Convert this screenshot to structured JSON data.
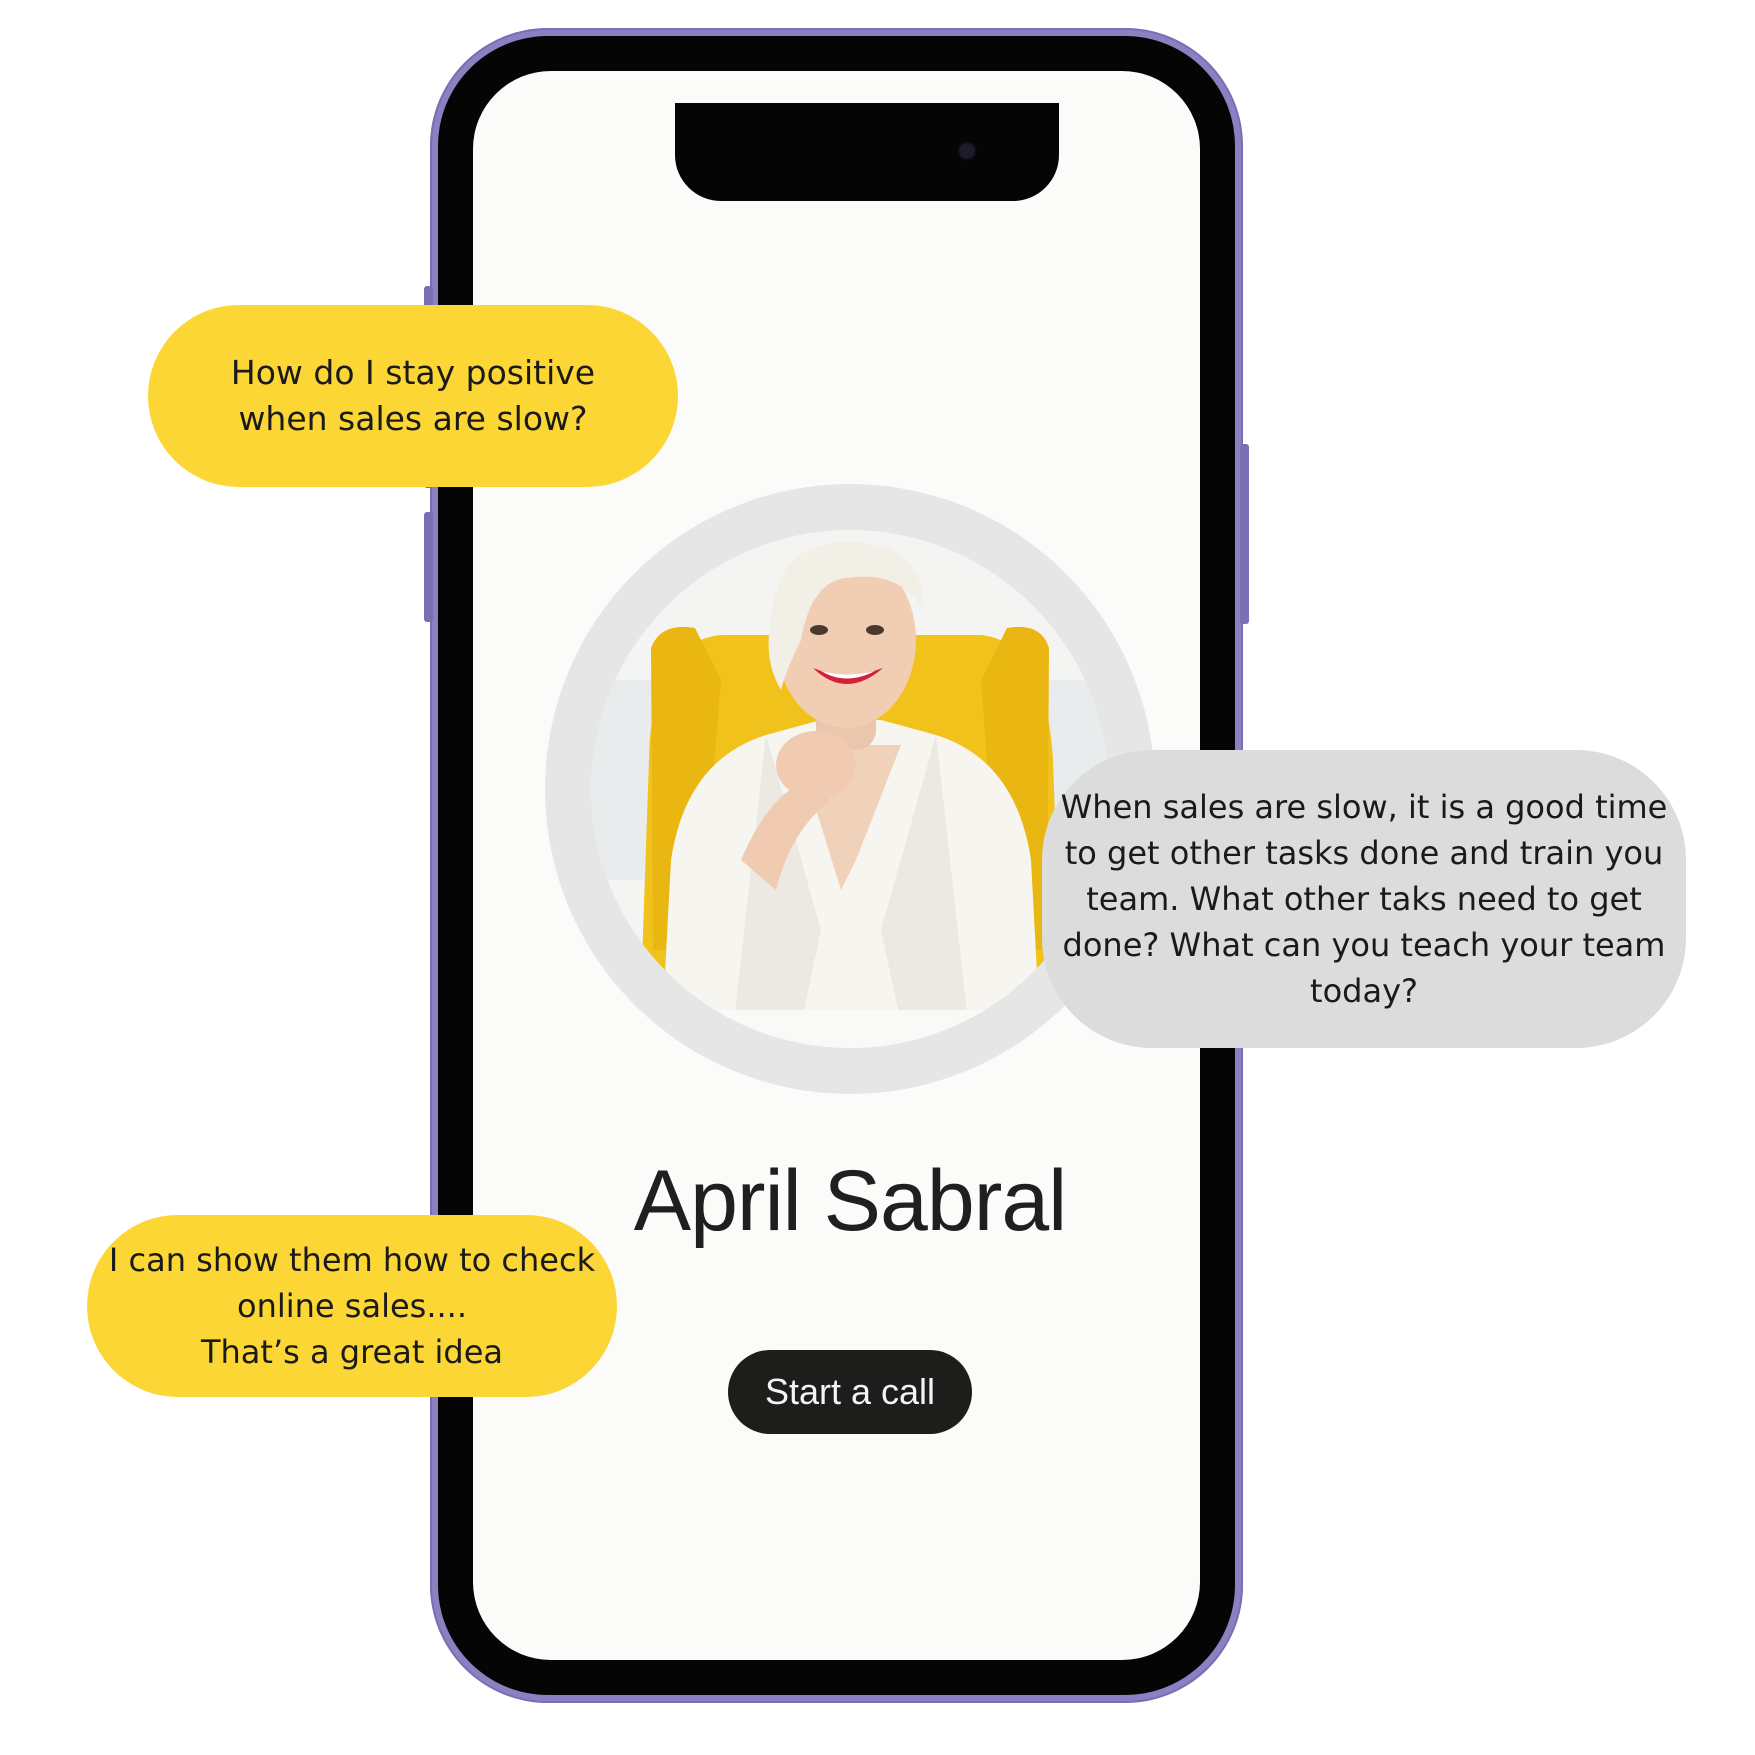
{
  "profile": {
    "name": "April Sabral",
    "photo": "portrait-photo"
  },
  "actions": {
    "start_call_label": "Start a call"
  },
  "chat": {
    "user_question": "How do I stay positive\nwhen sales are slow?",
    "coach_answer": "When sales are slow, it is a good time\nto get other tasks done and train you\nteam. What other taks need to get\ndone? What can you teach your team\ntoday?",
    "user_reply": "I can show them how to check\nonline sales....\nThat’s a great idea"
  },
  "colors": {
    "phone_frame": "#8c80c2",
    "user_bubble": "#fcd634",
    "coach_bubble": "#dcdcdc",
    "call_button": "#1d1d1b",
    "screen_background": "#fbfbf9"
  }
}
